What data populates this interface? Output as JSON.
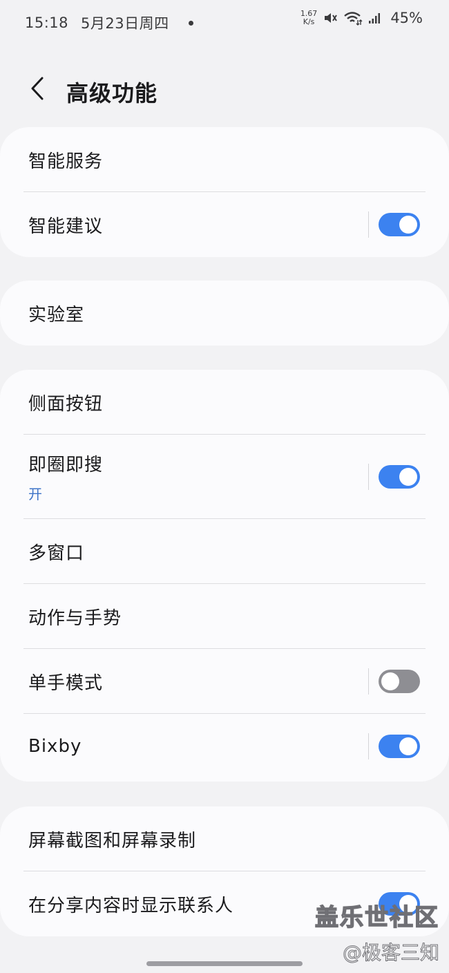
{
  "status_bar": {
    "time": "15:18",
    "date": "5月23日周四",
    "net_speed_value": "1.67",
    "net_speed_unit": "K/s",
    "battery": "45%",
    "icons": [
      "mute-icon",
      "wifi-icon",
      "signal-icon"
    ]
  },
  "header": {
    "back_icon": "chevron-left-icon",
    "title": "高级功能"
  },
  "groups": [
    {
      "items": [
        {
          "label": "智能服务"
        },
        {
          "label": "智能建议",
          "toggle": true
        }
      ]
    },
    {
      "items": [
        {
          "label": "实验室"
        }
      ]
    },
    {
      "items": [
        {
          "label": "侧面按钮"
        },
        {
          "label": "即圈即搜",
          "sublabel": "开",
          "toggle": true
        },
        {
          "label": "多窗口"
        },
        {
          "label": "动作与手势"
        },
        {
          "label": "单手模式",
          "toggle": false
        },
        {
          "label": "Bixby",
          "toggle": true
        }
      ]
    },
    {
      "items": [
        {
          "label": "屏幕截图和屏幕录制"
        },
        {
          "label": "在分享内容时显示联系人",
          "toggle": true
        }
      ]
    }
  ],
  "watermark": {
    "line1": "盖乐世社区",
    "line2": "@极客三知"
  },
  "colors": {
    "accent": "#3c82f0",
    "toggle_off": "#8e8e93",
    "background": "#f2f2f4",
    "card": "#fbfbfd",
    "sublabel": "#3e74c8"
  }
}
